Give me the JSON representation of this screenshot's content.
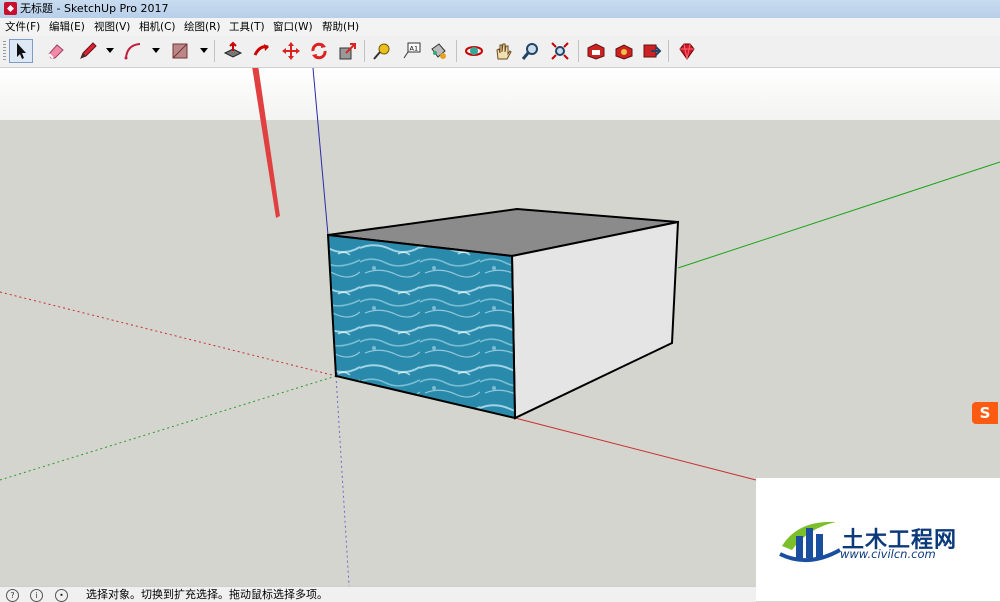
{
  "window": {
    "title": "无标题 - SketchUp Pro 2017"
  },
  "menu": [
    {
      "label": "文件(F)"
    },
    {
      "label": "编辑(E)"
    },
    {
      "label": "视图(V)"
    },
    {
      "label": "相机(C)"
    },
    {
      "label": "绘图(R)"
    },
    {
      "label": "工具(T)"
    },
    {
      "label": "窗口(W)"
    },
    {
      "label": "帮助(H)"
    }
  ],
  "toolbar": {
    "tools": [
      "select-icon",
      "eraser-icon",
      "pencil-icon",
      "arc-icon",
      "rectangle-icon",
      "push-pull-icon",
      "follow-me-icon",
      "move-icon",
      "rotate-icon",
      "scale-icon",
      "tape-measure-icon",
      "text-icon",
      "paint-bucket-icon",
      "orbit-icon",
      "pan-icon",
      "zoom-icon",
      "zoom-extents-icon",
      "3d-warehouse-icon",
      "extension-warehouse-icon",
      "share-model-icon",
      "ruby-icon"
    ],
    "text_tool_label": "A1"
  },
  "status": {
    "message": "选择对象。切换到扩充选择。拖动鼠标选择多项。"
  },
  "watermark": {
    "brand": "土木工程网",
    "url": "www.civilcn.com"
  },
  "ime": {
    "label": "S"
  },
  "colors": {
    "accent_red": "#e04040",
    "axis_blue": "#2a2aa8",
    "axis_green": "#1aa31a",
    "axis_red": "#c83030",
    "water": "#2f8fb0",
    "face_side": "#e6e6e6",
    "face_top": "#8a8a8a"
  }
}
